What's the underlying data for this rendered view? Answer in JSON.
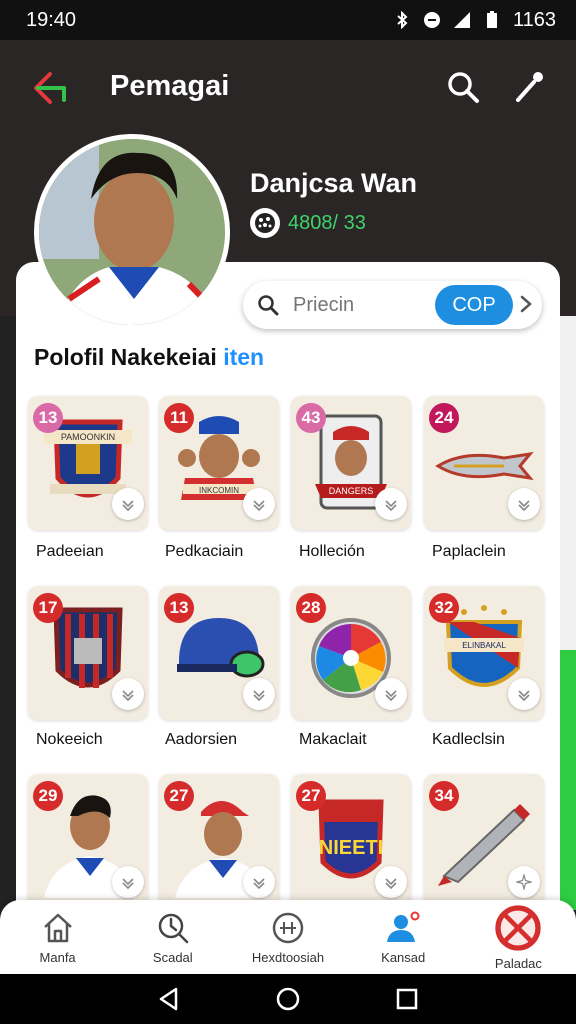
{
  "status": {
    "time": "19:40",
    "battery": "1163"
  },
  "header": {
    "title": "Pemagai"
  },
  "profile": {
    "name": "Danjcsa Wan",
    "coins": "4808/ 33"
  },
  "search": {
    "placeholder": "Priecin",
    "button": "COP"
  },
  "section": {
    "title_main": "Polofil Nakekeiai ",
    "title_accent": "iten"
  },
  "items": [
    {
      "badge": "13",
      "label": "Padeeian",
      "badge_color": "#d96aa6"
    },
    {
      "badge": "11",
      "label": "Pedkaciain",
      "badge_color": "#d62b2b"
    },
    {
      "badge": "43",
      "label": "Holleción",
      "badge_color": "#d96aa6"
    },
    {
      "badge": "24",
      "label": "Paplaclein",
      "badge_color": "#c2185b"
    },
    {
      "badge": "17",
      "label": "Nokeeich",
      "badge_color": "#d62b2b"
    },
    {
      "badge": "13",
      "label": "Aadorsien",
      "badge_color": "#d62b2b"
    },
    {
      "badge": "28",
      "label": "Makaclait",
      "badge_color": "#d62b2b"
    },
    {
      "badge": "32",
      "label": "Kadleclsin",
      "badge_color": "#d62b2b"
    },
    {
      "badge": "29",
      "label": "",
      "badge_color": "#d62b2b"
    },
    {
      "badge": "27",
      "label": "",
      "badge_color": "#d62b2b"
    },
    {
      "badge": "27",
      "label": "",
      "badge_color": "#d62b2b"
    },
    {
      "badge": "34",
      "label": "",
      "badge_color": "#d62b2b"
    }
  ],
  "item_art_text": [
    "PAMOONKIN",
    "INKCOMIN",
    "DANGERS",
    "NIEETI",
    "ELINBAKAL"
  ],
  "nav": [
    {
      "label": "Manfa",
      "icon": "home-icon"
    },
    {
      "label": "Scadal",
      "icon": "search-history-icon"
    },
    {
      "label": "Hexdtoosiah",
      "icon": "calculator-icon"
    },
    {
      "label": "Kansad",
      "icon": "user-icon"
    },
    {
      "label": "Paladac",
      "icon": "blocked-icon"
    }
  ],
  "colors": {
    "accent": "#1e8fe0",
    "coin": "#3fd16a",
    "header_bg": "#2a2626"
  }
}
